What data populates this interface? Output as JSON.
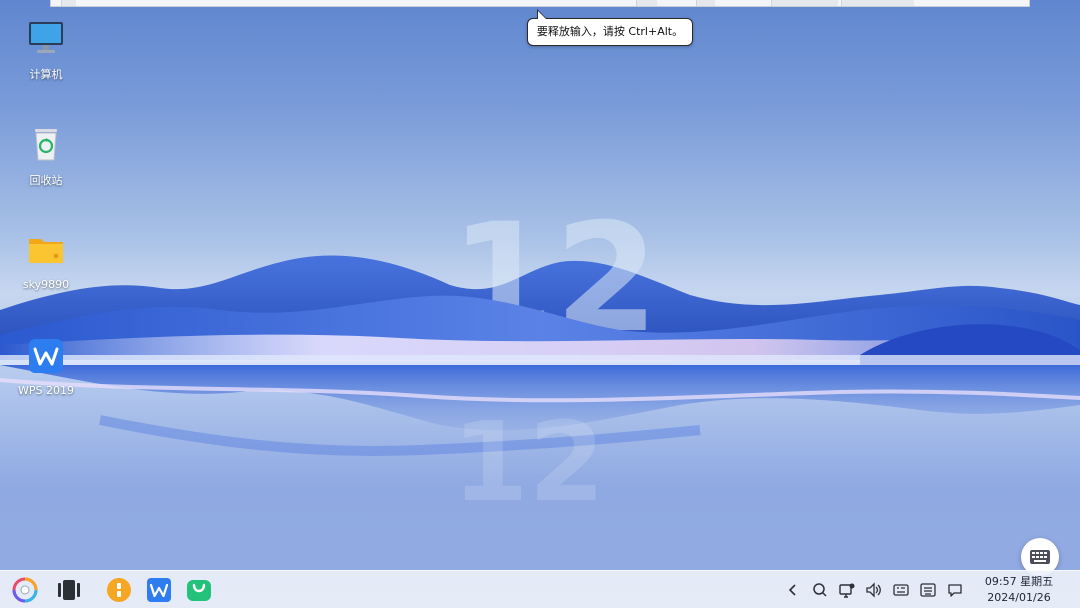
{
  "tooltip": {
    "text": "要释放输入，请按 Ctrl+Alt。"
  },
  "desktop_icons": [
    {
      "label": "计算机",
      "icon": "computer-icon"
    },
    {
      "label": "回收站",
      "icon": "recycle-bin-icon"
    },
    {
      "label": "sky9890",
      "icon": "folder-icon"
    },
    {
      "label": "WPS 2019",
      "icon": "wps-icon"
    }
  ],
  "taskbar": {
    "apps": [
      {
        "name": "start-menu-button",
        "icon": "launcher-icon"
      },
      {
        "name": "multitask-view-button",
        "icon": "multitask-icon"
      },
      {
        "name": "file-manager-button",
        "icon": "file-manager-icon"
      },
      {
        "name": "wps-button",
        "icon": "wps-icon"
      },
      {
        "name": "app-store-button",
        "icon": "app-store-icon"
      }
    ],
    "tray": [
      {
        "name": "tray-collapse-button",
        "icon": "chevron-left-icon"
      },
      {
        "name": "search-button",
        "icon": "search-icon"
      },
      {
        "name": "network-button",
        "icon": "network-icon"
      },
      {
        "name": "volume-button",
        "icon": "volume-icon"
      },
      {
        "name": "input-method-button",
        "icon": "input-method-icon"
      },
      {
        "name": "keyboard-button",
        "icon": "keyboard-icon"
      },
      {
        "name": "notification-button",
        "icon": "notification-icon"
      }
    ],
    "clock": {
      "time": "09:57 星期五",
      "date": "2024/01/26"
    }
  },
  "floating_keyboard": {
    "icon": "keyboard-icon"
  },
  "colors": {
    "sky_top": "#5f86cf",
    "horizon": "#c6d6ef",
    "wave_blue": "#2f5fd6",
    "taskbar": "#ecf0f8"
  }
}
